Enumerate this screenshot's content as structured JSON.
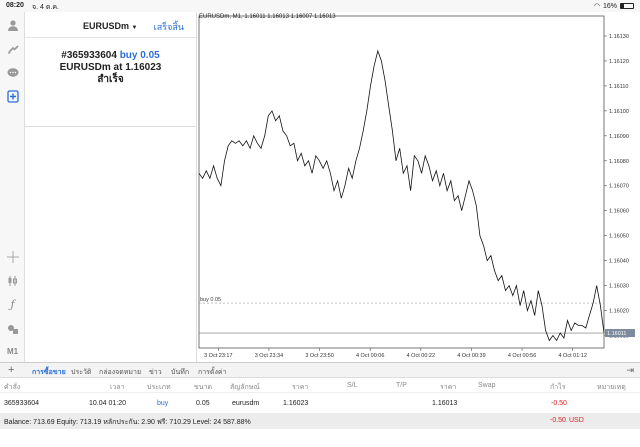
{
  "status": {
    "time": "08:20",
    "date": "จ. 4 ต.ค.",
    "battery": "16%"
  },
  "order_panel": {
    "symbol": "EURUSDm",
    "done_label": "เสร็จสิ้น",
    "ticket_line": "#365933604",
    "action": "buy 0.05",
    "price_prefix": "EURUSDm at",
    "price": "1.16023",
    "result": "สำเร็จ"
  },
  "left_toolbar": {
    "items": [
      "person-icon",
      "arrows-icon",
      "chat-icon",
      "new-order-icon"
    ],
    "bottom_items": [
      "crosshair-icon",
      "candle-icon",
      "function-icon",
      "objects-icon"
    ],
    "timeframe": "M1"
  },
  "chart": {
    "title": "EURUSDm, M1, 1.16011 1.16013 1.16007 1.16013",
    "order_line_label": "buy 0.05",
    "current_price_label": "1.16011",
    "y_ticks": [
      "1.16130",
      "1.16120",
      "1.16110",
      "1.16100",
      "1.16090",
      "1.16080",
      "1.16070",
      "1.16060",
      "1.16050",
      "1.16040",
      "1.16030",
      "1.16020",
      "1.16010"
    ],
    "x_ticks": [
      "3 Oct 23:17",
      "3 Oct 23:34",
      "3 Oct 23:50",
      "4 Oct 00:06",
      "4 Oct 00:22",
      "4 Oct 00:39",
      "4 Oct 00:56",
      "4 Oct 01:12"
    ]
  },
  "chart_data": {
    "type": "line",
    "title": "EURUSDm, M1, 1.16011 1.16013 1.16007 1.16013",
    "xlabel": "",
    "ylabel": "",
    "ylim": [
      1.16005,
      1.16138
    ],
    "x": [
      "3 Oct 23:17",
      "3 Oct 23:34",
      "3 Oct 23:50",
      "4 Oct 00:06",
      "4 Oct 00:22",
      "4 Oct 00:39",
      "4 Oct 00:56",
      "4 Oct 01:12"
    ],
    "series": [
      {
        "values": [
          1.16075,
          1.16073,
          1.16076,
          1.16073,
          1.16078,
          1.16073,
          1.1607,
          1.1608,
          1.16086,
          1.16088,
          1.16087,
          1.16088,
          1.16086,
          1.16088,
          1.16085,
          1.1609,
          1.16087,
          1.16085,
          1.1609,
          1.16098,
          1.161,
          1.16096,
          1.16098,
          1.16092,
          1.1609,
          1.16086,
          1.16087,
          1.1608,
          1.16083,
          1.16078,
          1.1608,
          1.16075,
          1.16082,
          1.1608,
          1.16077,
          1.1608,
          1.16075,
          1.16068,
          1.16072,
          1.16065,
          1.1607,
          1.16077,
          1.16073,
          1.1608,
          1.16085,
          1.16092,
          1.161,
          1.1611,
          1.16118,
          1.16124,
          1.1612,
          1.16112,
          1.16102,
          1.16092,
          1.1608,
          1.16085,
          1.16075,
          1.16078,
          1.16068,
          1.16082,
          1.1608,
          1.16075,
          1.16082,
          1.16078,
          1.16072,
          1.16076,
          1.1607,
          1.16075,
          1.16068,
          1.16072,
          1.16064,
          1.16066,
          1.1606,
          1.16066,
          1.16072,
          1.16068,
          1.16062,
          1.1605,
          1.16046,
          1.1604,
          1.16042,
          1.16036,
          1.16032,
          1.16034,
          1.16028,
          1.1603,
          1.16026,
          1.1603,
          1.16022,
          1.16028,
          1.1602,
          1.16024,
          1.16018,
          1.16028,
          1.16022,
          1.16012,
          1.16008,
          1.1601,
          1.16008,
          1.16011,
          1.16009,
          1.16016,
          1.16012,
          1.16015,
          1.16014,
          1.16014,
          1.16013,
          1.16018,
          1.16023,
          1.1603,
          1.16022,
          1.16011
        ]
      }
    ],
    "order_level": 1.16023,
    "current_price": 1.16011
  },
  "tabs": [
    "การซื้อขาย",
    "ประวัติ",
    "กล่องจดหมาย",
    "ข่าว",
    "บันทึก",
    "การตั้งค่า"
  ],
  "table": {
    "headers": [
      "คำสั่ง",
      "เวลา",
      "ประเภท",
      "ขนาด",
      "สัญลักษณ์",
      "ราคา",
      "S/L",
      "T/P",
      "ราคา",
      "Swap",
      "กำไร",
      "หมายเหตุ"
    ],
    "row": {
      "ticket": "365933604",
      "time": "10.04 01:20",
      "type": "buy",
      "size": "0.05",
      "symbol": "eurusdm",
      "price": "1.16023",
      "current": "1.16013",
      "profit": "-0.50"
    }
  },
  "balance": {
    "text": "Balance: 713.69 Equity: 713.19 หลักประกัน: 2.90 ฟรี: 710.29 Level: 24 587.88%",
    "profit": "-0.50",
    "currency": "USD"
  },
  "colors": {
    "accent": "#2a6fd8",
    "negative": "#e02020"
  }
}
